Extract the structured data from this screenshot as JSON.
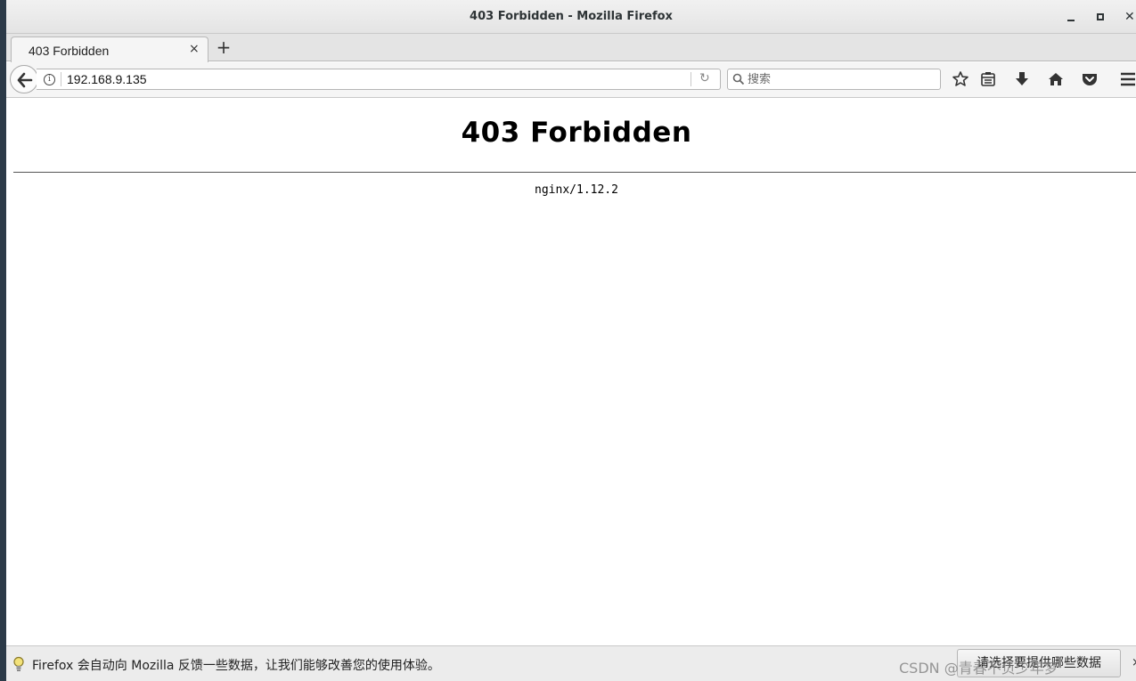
{
  "window": {
    "title": "403 Forbidden - Mozilla Firefox"
  },
  "tabs": [
    {
      "label": "403 Forbidden",
      "close": "×"
    }
  ],
  "newtab_label": "+",
  "navbar": {
    "url": "192.168.9.135",
    "search_placeholder": "搜索",
    "icons": [
      "back-arrow-icon",
      "info-icon",
      "reload-icon",
      "search-icon",
      "bookmark-star-icon",
      "reading-list-icon",
      "download-icon",
      "home-icon",
      "pocket-icon",
      "hamburger-menu-icon"
    ]
  },
  "page": {
    "heading": "403 Forbidden",
    "server": "nginx/1.12.2"
  },
  "notification": {
    "text": "Firefox 会自动向 Mozilla 反馈一些数据，让我们能够改善您的使用体验。",
    "button_label": "请选择要提供哪些数据",
    "close": "×"
  },
  "watermark": "CSDN @青春不负少年梦",
  "colors": {
    "desktop": "#2c3a48",
    "chrome": "#f5f5f5",
    "notification_bg": "#ececec"
  }
}
